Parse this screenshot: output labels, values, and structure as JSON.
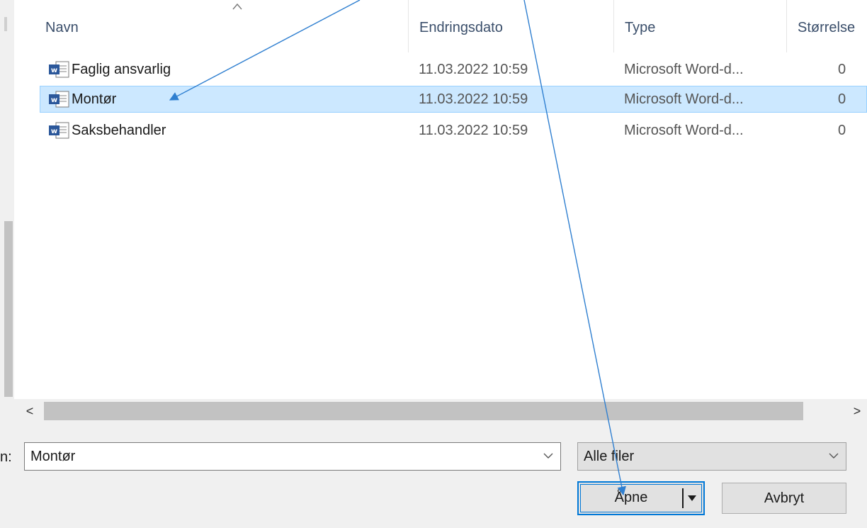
{
  "columns": {
    "name": "Navn",
    "date": "Endringsdato",
    "type": "Type",
    "size": "Størrelse"
  },
  "files": [
    {
      "name": "Faglig ansvarlig",
      "date": "11.03.2022 10:59",
      "type": "Microsoft Word-d...",
      "size": "0",
      "icon": "word-document-icon",
      "selected": false
    },
    {
      "name": "Montør",
      "date": "11.03.2022 10:59",
      "type": "Microsoft Word-d...",
      "size": "0",
      "icon": "word-document-icon",
      "selected": true
    },
    {
      "name": "Saksbehandler",
      "date": "11.03.2022 10:59",
      "type": "Microsoft Word-d...",
      "size": "0",
      "icon": "word-document-icon",
      "selected": false
    }
  ],
  "scroll": {
    "left_arrow": "<",
    "right_arrow": ">"
  },
  "filename_field": {
    "label": "n:",
    "value": "Montør"
  },
  "file_type": {
    "selected": "Alle filer"
  },
  "buttons": {
    "open": "Åpne",
    "cancel": "Avbryt"
  },
  "colors": {
    "selection_bg": "#cce8ff",
    "selection_border": "#99d1ff",
    "accent": "#0078d7",
    "annotation_arrow": "#2f7fd0",
    "word_blue": "#2b579a"
  }
}
